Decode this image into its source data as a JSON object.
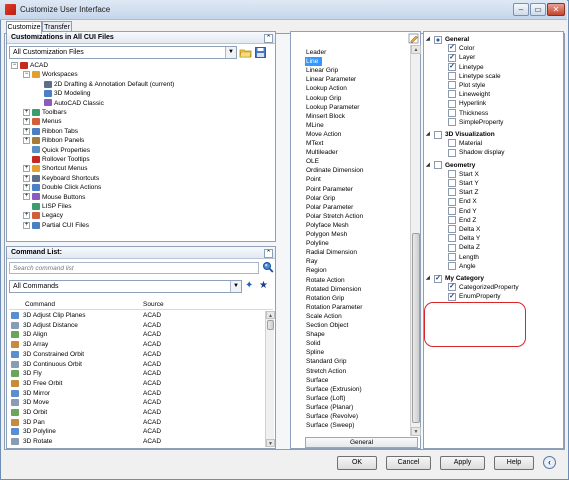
{
  "window": {
    "title": "Customize User Interface",
    "controls": [
      "–",
      "▭",
      "✕"
    ]
  },
  "tabs": [
    {
      "label": "Customize",
      "active": true
    },
    {
      "label": "Transfer",
      "active": false
    }
  ],
  "customizations": {
    "header": "Customizations in All CUI Files",
    "filter_value": "All Customization Files",
    "tree": [
      {
        "label": "ACAD",
        "level": 0,
        "expander": "−",
        "icon": "acad-icon"
      },
      {
        "label": "Workspaces",
        "level": 1,
        "expander": "−",
        "icon": "workspaces-icon"
      },
      {
        "label": "2D Drafting & Annotation Default (current)",
        "level": 2,
        "expander": "",
        "icon": "workspace-icon"
      },
      {
        "label": "3D Modeling",
        "level": 2,
        "expander": "",
        "icon": "workspace-icon"
      },
      {
        "label": "AutoCAD Classic",
        "level": 2,
        "expander": "",
        "icon": "workspace-icon"
      },
      {
        "label": "Toolbars",
        "level": 1,
        "expander": "+",
        "icon": "toolbars-icon"
      },
      {
        "label": "Menus",
        "level": 1,
        "expander": "+",
        "icon": "menus-icon"
      },
      {
        "label": "Ribbon Tabs",
        "level": 1,
        "expander": "+",
        "icon": "ribbon-tabs-icon"
      },
      {
        "label": "Ribbon Panels",
        "level": 1,
        "expander": "+",
        "icon": "ribbon-panels-icon"
      },
      {
        "label": "Quick Properties",
        "level": 1,
        "expander": "",
        "icon": "quick-properties-icon"
      },
      {
        "label": "Rollover Tooltips",
        "level": 1,
        "expander": "",
        "icon": "rollover-tooltips-icon"
      },
      {
        "label": "Shortcut Menus",
        "level": 1,
        "expander": "+",
        "icon": "shortcut-menus-icon"
      },
      {
        "label": "Keyboard Shortcuts",
        "level": 1,
        "expander": "+",
        "icon": "keyboard-shortcuts-icon"
      },
      {
        "label": "Double Click Actions",
        "level": 1,
        "expander": "+",
        "icon": "double-click-icon"
      },
      {
        "label": "Mouse Buttons",
        "level": 1,
        "expander": "+",
        "icon": "mouse-buttons-icon"
      },
      {
        "label": "LISP Files",
        "level": 1,
        "expander": "",
        "icon": "lisp-files-icon"
      },
      {
        "label": "Legacy",
        "level": 1,
        "expander": "+",
        "icon": "legacy-icon"
      },
      {
        "label": "Partial CUI Files",
        "level": 1,
        "expander": "+",
        "icon": "partial-cui-icon"
      }
    ]
  },
  "command_list": {
    "header": "Command List:",
    "search_placeholder": "Search command list",
    "filter_value": "All Commands",
    "columns": [
      "Command",
      "Source"
    ],
    "rows": [
      {
        "command": "3D Adjust Clip Planes",
        "source": "ACAD"
      },
      {
        "command": "3D Adjust Distance",
        "source": "ACAD"
      },
      {
        "command": "3D Align",
        "source": "ACAD"
      },
      {
        "command": "3D Array",
        "source": "ACAD"
      },
      {
        "command": "3D Constrained Orbit",
        "source": "ACAD"
      },
      {
        "command": "3D Continuous Orbit",
        "source": "ACAD"
      },
      {
        "command": "3D Fly",
        "source": "ACAD"
      },
      {
        "command": "3D Free Orbit",
        "source": "ACAD"
      },
      {
        "command": "3D Mirror",
        "source": "ACAD"
      },
      {
        "command": "3D Move",
        "source": "ACAD"
      },
      {
        "command": "3D Orbit",
        "source": "ACAD"
      },
      {
        "command": "3D Pan",
        "source": "ACAD"
      },
      {
        "command": "3D Polyline",
        "source": "ACAD"
      },
      {
        "command": "3D Rotate",
        "source": "ACAD"
      }
    ]
  },
  "object_types": {
    "selected": "Line",
    "items": [
      "Leader",
      "Line",
      "Linear Grip",
      "Linear Parameter",
      "Lookup Action",
      "Lookup Grip",
      "Lookup Parameter",
      "Minsert Block",
      "MLine",
      "Move Action",
      "MText",
      "Multileader",
      "OLE",
      "Ordinate Dimension",
      "Point",
      "Point Parameter",
      "Polar Grip",
      "Polar Parameter",
      "Polar Stretch Action",
      "Polyface Mesh",
      "Polygon Mesh",
      "Polyline",
      "Radial Dimension",
      "Ray",
      "Region",
      "Rotate Action",
      "Rotated Dimension",
      "Rotation Grip",
      "Rotation Parameter",
      "Scale Action",
      "Section Object",
      "Shape",
      "Solid",
      "Spline",
      "Standard Grip",
      "Stretch Action",
      "Surface",
      "Surface (Extrusion)",
      "Surface (Loft)",
      "Surface (Planar)",
      "Surface (Revolve)",
      "Surface (Sweep)"
    ],
    "footer_button": "General"
  },
  "properties": {
    "rows": [
      {
        "label": "General",
        "category": true,
        "checked": "mixed"
      },
      {
        "label": "Color",
        "checked": true
      },
      {
        "label": "Layer",
        "checked": true
      },
      {
        "label": "Linetype",
        "checked": true
      },
      {
        "label": "Linetype scale",
        "checked": false
      },
      {
        "label": "Plot style",
        "checked": false
      },
      {
        "label": "Lineweight",
        "checked": false
      },
      {
        "label": "Hyperlink",
        "checked": false
      },
      {
        "label": "Thickness",
        "checked": false
      },
      {
        "label": "SimpleProperty",
        "checked": false
      },
      {
        "label": "3D Visualization",
        "category": true,
        "checked": false
      },
      {
        "label": "Material",
        "checked": false
      },
      {
        "label": "Shadow display",
        "checked": false
      },
      {
        "label": "Geometry",
        "category": true,
        "checked": false
      },
      {
        "label": "Start X",
        "checked": false
      },
      {
        "label": "Start Y",
        "checked": false
      },
      {
        "label": "Start Z",
        "checked": false
      },
      {
        "label": "End X",
        "checked": false
      },
      {
        "label": "End Y",
        "checked": false
      },
      {
        "label": "End Z",
        "checked": false
      },
      {
        "label": "Delta X",
        "checked": false
      },
      {
        "label": "Delta Y",
        "checked": false
      },
      {
        "label": "Delta Z",
        "checked": false
      },
      {
        "label": "Length",
        "checked": false
      },
      {
        "label": "Angle",
        "checked": false
      },
      {
        "label": "My Category",
        "category": true,
        "checked": true
      },
      {
        "label": "CategorizedProperty",
        "checked": true
      },
      {
        "label": "EnumProperty",
        "checked": true
      }
    ]
  },
  "buttons": {
    "ok": "OK",
    "cancel": "Cancel",
    "apply": "Apply",
    "help": "Help"
  },
  "colors": {
    "selection": "#3399ff",
    "highlight_ring": "#d9262b",
    "frame": "#6e8db5"
  }
}
